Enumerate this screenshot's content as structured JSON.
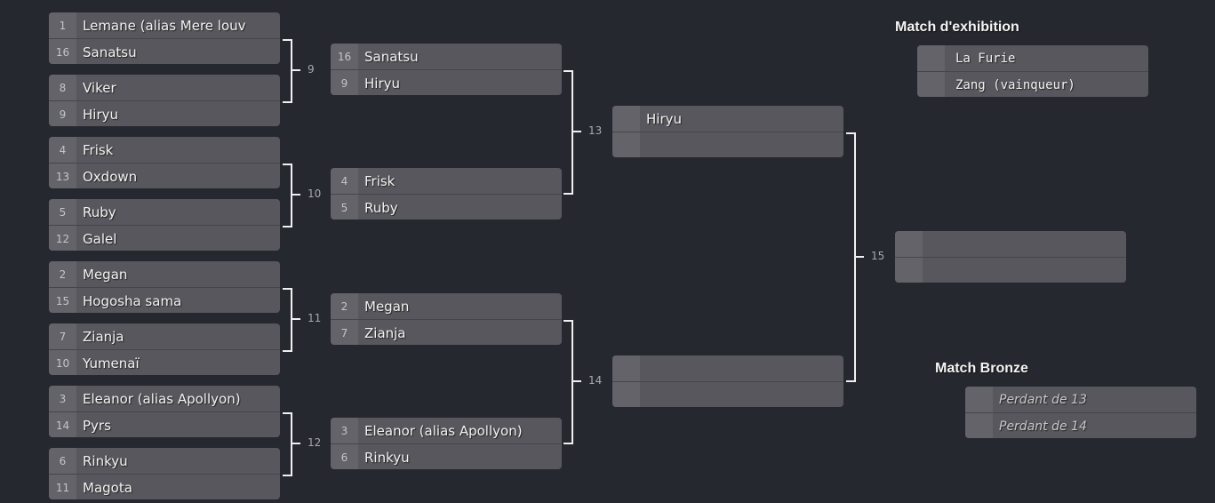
{
  "rounds": [
    [
      [
        {
          "seed": "1",
          "name": "Lemane (alias Mere louv"
        },
        {
          "seed": "16",
          "name": "Sanatsu"
        }
      ],
      [
        {
          "seed": "8",
          "name": "Viker"
        },
        {
          "seed": "9",
          "name": "Hiryu"
        }
      ],
      [
        {
          "seed": "4",
          "name": "Frisk"
        },
        {
          "seed": "13",
          "name": "Oxdown"
        }
      ],
      [
        {
          "seed": "5",
          "name": "Ruby"
        },
        {
          "seed": "12",
          "name": "Galel"
        }
      ],
      [
        {
          "seed": "2",
          "name": "Megan"
        },
        {
          "seed": "15",
          "name": "Hogosha sama"
        }
      ],
      [
        {
          "seed": "7",
          "name": "Zianja"
        },
        {
          "seed": "10",
          "name": "Yumenaï"
        }
      ],
      [
        {
          "seed": "3",
          "name": "Eleanor (alias Apollyon)"
        },
        {
          "seed": "14",
          "name": "Pyrs"
        }
      ],
      [
        {
          "seed": "6",
          "name": "Rinkyu"
        },
        {
          "seed": "11",
          "name": "Magota"
        }
      ]
    ],
    [
      [
        {
          "seed": "16",
          "name": "Sanatsu"
        },
        {
          "seed": "9",
          "name": "Hiryu"
        }
      ],
      [
        {
          "seed": "4",
          "name": "Frisk"
        },
        {
          "seed": "5",
          "name": "Ruby"
        }
      ],
      [
        {
          "seed": "2",
          "name": "Megan"
        },
        {
          "seed": "7",
          "name": "Zianja"
        }
      ],
      [
        {
          "seed": "3",
          "name": "Eleanor (alias Apollyon)"
        },
        {
          "seed": "6",
          "name": "Rinkyu"
        }
      ]
    ],
    [
      [
        {
          "seed": "",
          "name": "Hiryu"
        },
        {
          "seed": "",
          "name": ""
        }
      ],
      [
        {
          "seed": "",
          "name": ""
        },
        {
          "seed": "",
          "name": ""
        }
      ]
    ],
    [
      [
        {
          "seed": "",
          "name": ""
        },
        {
          "seed": "",
          "name": ""
        }
      ]
    ]
  ],
  "match_numbers": [
    "9",
    "10",
    "11",
    "12",
    "13",
    "14",
    "15"
  ],
  "exhibition": {
    "title": "Match d'exhibition",
    "players": [
      "La Furie",
      "Zang  (vainqueur)"
    ]
  },
  "bronze": {
    "title": "Match Bronze",
    "players": [
      "Perdant de 13",
      "Perdant de 14"
    ]
  }
}
